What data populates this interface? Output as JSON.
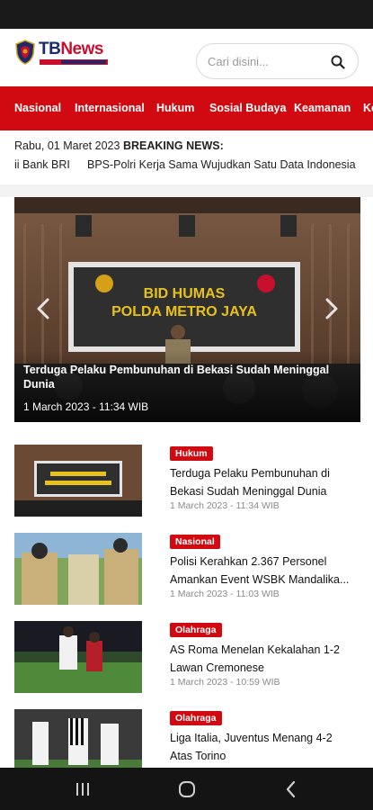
{
  "header": {
    "logo": {
      "text_tb": "TB",
      "text_news": "News"
    },
    "search": {
      "placeholder": "Cari disini..."
    }
  },
  "nav": {
    "items": [
      "Nasional",
      "Internasional",
      "Hukum",
      "Sosial Budaya",
      "Keamanan",
      "Ke"
    ]
  },
  "breaking": {
    "date": "Rabu, 01 Maret 2023",
    "label": "BREAKING NEWS:",
    "ticker": [
      "ii Bank BRI",
      "BPS-Polri Kerja Sama Wujudkan Satu Data Indonesia"
    ]
  },
  "hero": {
    "sign_line1": "BID HUMAS",
    "sign_line2": "POLDA METRO JAYA",
    "title": "Terduga Pelaku Pembunuhan di Bekasi Sudah Meninggal Dunia",
    "date": "1 March 2023 - 11:34 WIB"
  },
  "articles": [
    {
      "category": "Hukum",
      "title": "Terduga Pelaku Pembunuhan di Bekasi Sudah Meninggal Dunia",
      "date": "1 March 2023 - 11:34 WIB"
    },
    {
      "category": "Nasional",
      "title": "Polisi Kerahkan 2.367 Personel Amankan Event WSBK Mandalika...",
      "date": "1 March 2023 - 11:03 WIB"
    },
    {
      "category": "Olahraga",
      "title": "AS Roma Menelan Kekalahan 1-2 Lawan Cremonese",
      "date": "1 March 2023 - 10:59 WIB"
    },
    {
      "category": "Olahraga",
      "title": "Liga Italia, Juventus Menang 4-2 Atas Torino",
      "date": ""
    }
  ],
  "colors": {
    "accent": "#d10a11",
    "brand_blue": "#1a2a6b"
  },
  "icons": {
    "search": "search-icon",
    "prev": "chevron-left-icon",
    "next": "chevron-right-icon",
    "android_recents": "recents-icon",
    "android_home": "home-icon",
    "android_back": "back-icon"
  }
}
